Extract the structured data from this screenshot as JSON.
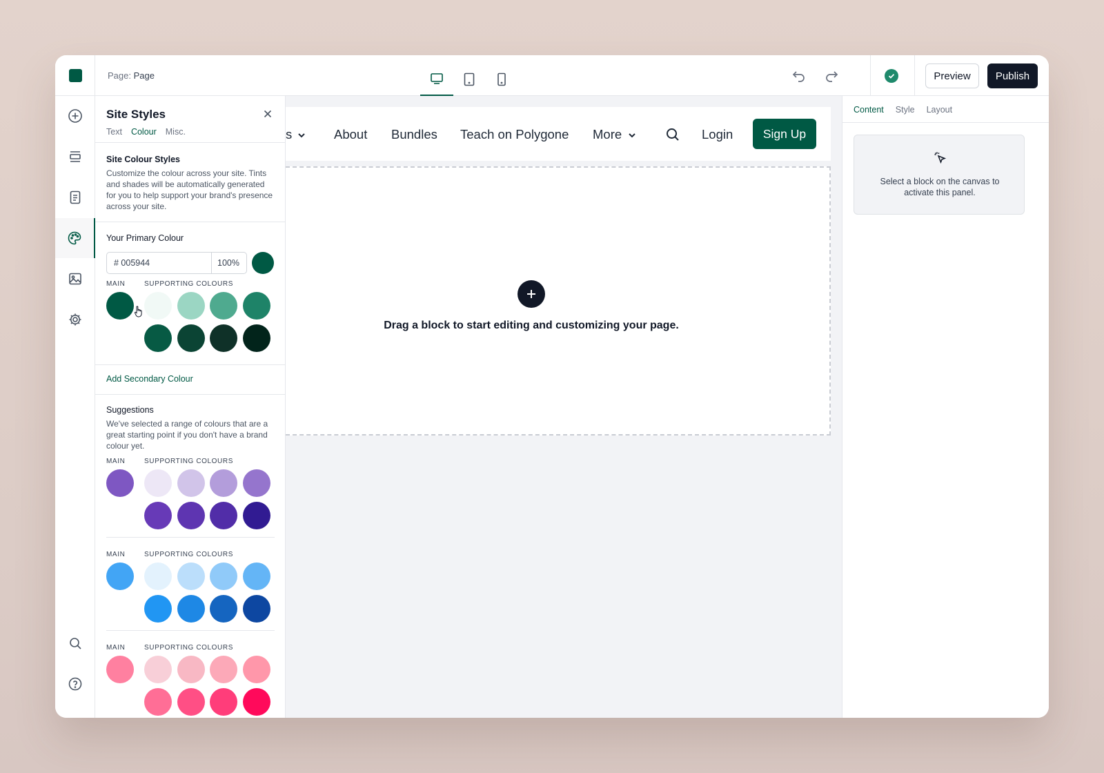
{
  "topbar": {
    "page_prefix": "Page:",
    "page_name": "Page",
    "preview_label": "Preview",
    "publish_label": "Publish"
  },
  "style_panel": {
    "title": "Site Styles",
    "tabs": [
      "Text",
      "Colour",
      "Misc."
    ],
    "active_tab": "Colour",
    "colour_section_title": "Site Colour Styles",
    "colour_section_desc": "Customize the colour across your site. Tints and shades will be automatically generated for you to help support your brand's presence across your site.",
    "primary_title": "Your Primary Colour",
    "primary_hex": "# 005944",
    "primary_opacity": "100%",
    "primary_color": "#005944",
    "main_label": "MAIN",
    "supporting_label": "SUPPORTING COLOURS",
    "primary_palette": {
      "main": "#005944",
      "supporting": [
        "#f1f9f6",
        "#9bd6c3",
        "#4faa8f",
        "#1e8368",
        "#075a44",
        "#0b4434",
        "#0f3128",
        "#02241b"
      ]
    },
    "add_secondary_label": "Add Secondary Colour",
    "suggestions_title": "Suggestions",
    "suggestions_desc": "We've selected a range of colours that are a great starting point if you don't have a brand colour yet.",
    "suggestions": [
      {
        "main": "#7e57c2",
        "supporting": [
          "#ede7f6",
          "#d1c4e9",
          "#b39ddb",
          "#9575cd",
          "#673ab7",
          "#5e35b1",
          "#512da8",
          "#311b92"
        ]
      },
      {
        "main": "#42a5f5",
        "supporting": [
          "#e3f2fd",
          "#bbdefb",
          "#90caf9",
          "#64b5f6",
          "#2196f3",
          "#1e88e5",
          "#1565c0",
          "#0d47a1"
        ]
      },
      {
        "main": "#ff80a0",
        "supporting": [
          "#f8cfd8",
          "#f8b8c4",
          "#fca9b8",
          "#ff97aa",
          "#ff6e96",
          "#ff4f85",
          "#ff3d7a",
          "#ff0a5b"
        ]
      }
    ]
  },
  "rail": {
    "icons": [
      "add-icon",
      "sections-icon",
      "pages-icon",
      "palette-icon",
      "image-icon",
      "settings-icon",
      "search-icon",
      "help-icon"
    ]
  },
  "canvas": {
    "nav_items": [
      "s",
      "About",
      "Bundles",
      "Teach on Polygone",
      "More",
      "Login"
    ],
    "signup_label": "Sign Up",
    "drop_text": "Drag a block to start editing and customizing your page."
  },
  "inspector": {
    "tabs": [
      "Content",
      "Style",
      "Layout"
    ],
    "active_tab": "Content",
    "hint": "Select a block on the canvas to activate this panel."
  }
}
